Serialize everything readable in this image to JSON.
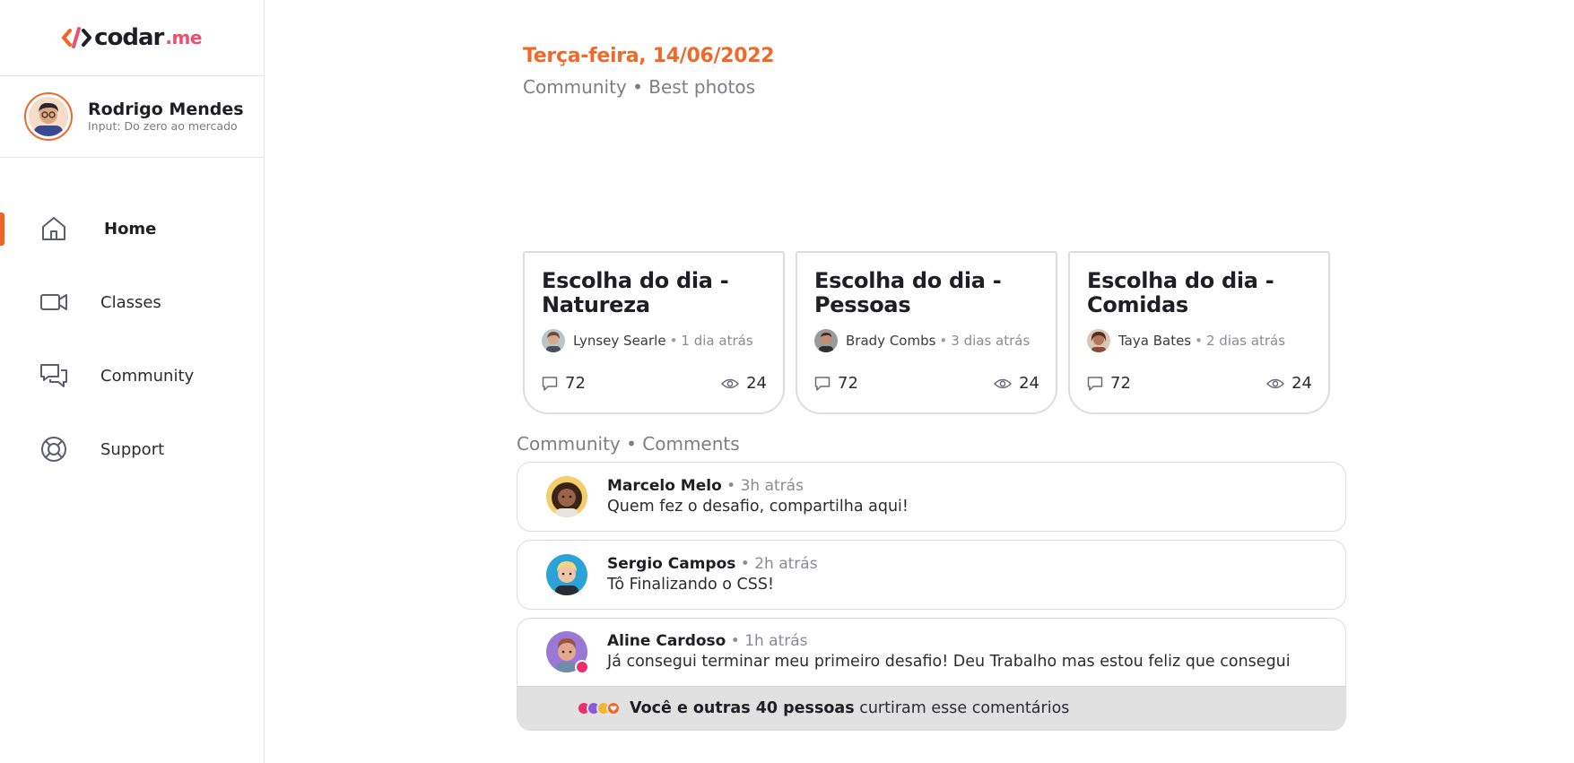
{
  "sidebar": {
    "logo": {
      "text": "codar",
      "suffix": ".me"
    },
    "profile": {
      "name": "Rodrigo Mendes",
      "subtitle": "Input: Do zero ao mercado"
    },
    "items": [
      {
        "label": "Home",
        "icon": "home-icon",
        "active": true
      },
      {
        "label": "Classes",
        "icon": "video-camera-icon",
        "active": false
      },
      {
        "label": "Community",
        "icon": "chat-bubbles-icon",
        "active": false
      },
      {
        "label": "Support",
        "icon": "lifebuoy-icon",
        "active": false
      }
    ]
  },
  "header": {
    "date": "Terça-feira, 14/06/2022",
    "breadcrumb": "Community • Best photos"
  },
  "cards": [
    {
      "title": "Escolha do dia - Natureza",
      "author": "Lynsey Searle",
      "time": "1 dia atrás",
      "comments": "72",
      "views": "24"
    },
    {
      "title": "Escolha do dia - Pessoas",
      "author": "Brady Combs",
      "time": "3 dias atrás",
      "comments": "72",
      "views": "24"
    },
    {
      "title": "Escolha do dia - Comidas",
      "author": "Taya Bates",
      "time": "2 dias atrás",
      "comments": "72",
      "views": "24"
    }
  ],
  "comments_section": {
    "label": "Community • Comments",
    "items": [
      {
        "name": "Marcelo Melo",
        "time": "3h atrás",
        "text": "Quem fez o desafio, compartilha aqui!"
      },
      {
        "name": "Sergio Campos",
        "time": "2h atrás",
        "text": "Tô Finalizando o CSS!"
      },
      {
        "name": "Aline Cardoso",
        "time": "1h atrás",
        "text": "Já consegui terminar meu primeiro desafio! Deu Trabalho mas estou feliz que consegui"
      }
    ],
    "likes": {
      "bold": "Você e outras 40 pessoas",
      "rest": "curtiram esse comentários"
    }
  },
  "colors": {
    "accent": "#ef6a2a",
    "brand_pink": "#ef4f6e",
    "indicator": "#f26522",
    "likes_bg": "#e1e1e1"
  }
}
